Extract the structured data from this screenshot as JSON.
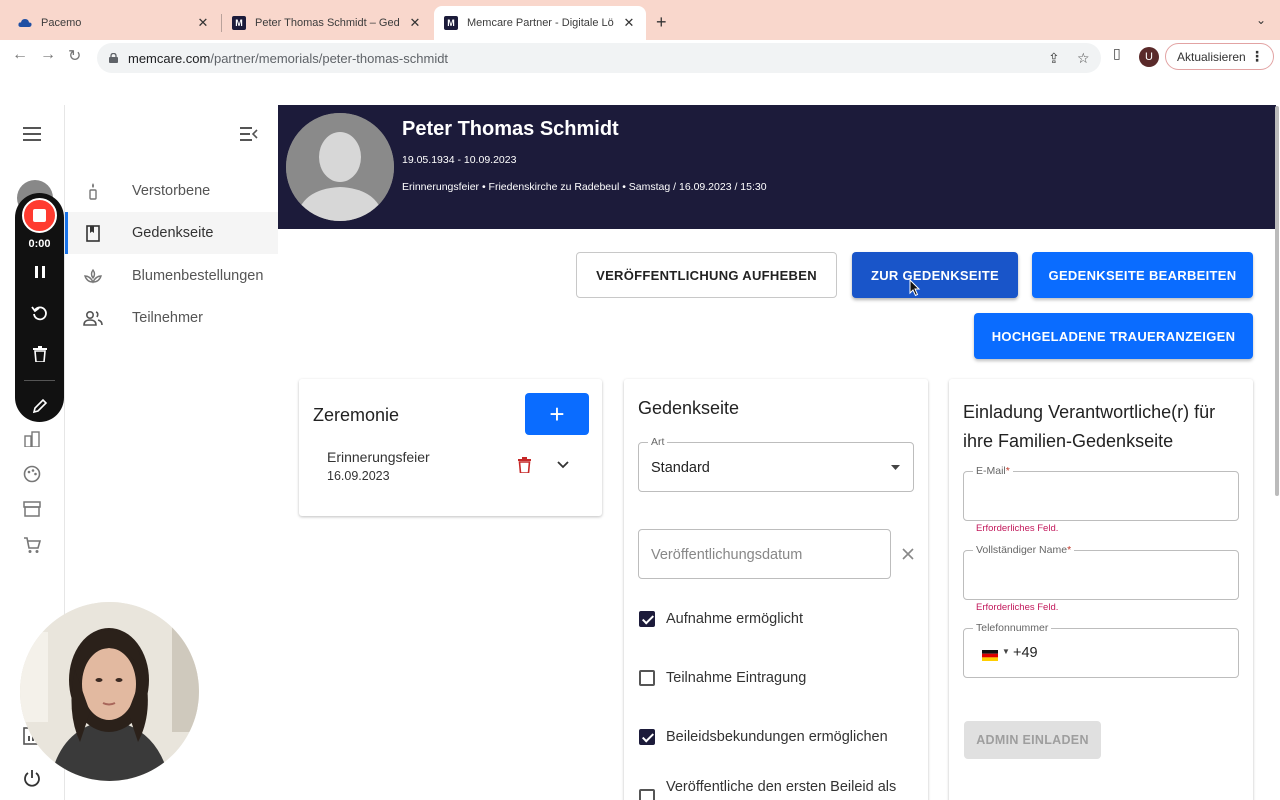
{
  "browser": {
    "tabs": [
      {
        "title": "Pacemo",
        "favicon": "cloud-icon"
      },
      {
        "title": "Peter Thomas Schmidt – Gedenkseite",
        "favicon": "memcare-icon"
      },
      {
        "title": "Memcare Partner - Digitale Lösungen",
        "favicon": "memcare-icon"
      }
    ],
    "url_domain": "memcare.com",
    "url_path": "/partner/memorials/peter-thomas-schmidt",
    "update_button": "Aktualisieren",
    "profile_initial": "U"
  },
  "sidenav": {
    "items": [
      {
        "label": "Verstorbene",
        "icon": "candle-icon"
      },
      {
        "label": "Gedenkseite",
        "icon": "book-icon"
      },
      {
        "label": "Blumenbestellungen",
        "icon": "flower-icon"
      },
      {
        "label": "Teilnehmer",
        "icon": "people-icon"
      }
    ]
  },
  "header": {
    "name": "Peter Thomas Schmidt",
    "dates": "19.05.1934 - 10.09.2023",
    "event": "Erinnerungsfeier • Friedenskirche zu Radebeul • Samstag / 16.09.2023 / 15:30"
  },
  "actions": {
    "unpublish": "VERÖFFENTLICHUNG AUFHEBEN",
    "to_memorial": "ZUR GEDENKSEITE",
    "edit_memorial": "GEDENKSEITE BEARBEITEN",
    "uploaded_notices": "HOCHGELADENE TRAUERANZEIGEN"
  },
  "ceremony": {
    "title": "Zeremonie",
    "add_label": "+",
    "item_name": "Erinnerungsfeier",
    "item_date": "16.09.2023"
  },
  "memorial": {
    "title": "Gedenkseite",
    "type_label": "Art",
    "type_value": "Standard",
    "publish_date_placeholder": "Veröffentlichungsdatum",
    "options": [
      {
        "label": "Aufnahme ermöglicht",
        "checked": true
      },
      {
        "label": "Teilnahme Eintragung",
        "checked": false
      },
      {
        "label": "Beileidsbekundungen ermöglichen",
        "checked": true
      },
      {
        "label": "Veröffentliche den ersten Beileid als",
        "checked": false
      }
    ]
  },
  "invite": {
    "title_line1": "Einladung Verantwortliche(r) für",
    "title_line2": "ihre Familien-Gedenkseite",
    "email_label": "E-Mail",
    "name_label": "Vollständiger Name",
    "phone_label": "Telefonnummer",
    "phone_prefix": "+49",
    "required_mark": "*",
    "error_text": "Erforderliches Feld.",
    "admin_button": "ADMIN EINLADEN"
  },
  "recorder": {
    "time": "0:00"
  },
  "colors": {
    "header_bg": "#1c1b3a",
    "primary_blue": "#0a6cff",
    "error": "#c2185b",
    "tabbar": "#f9d7cc"
  }
}
